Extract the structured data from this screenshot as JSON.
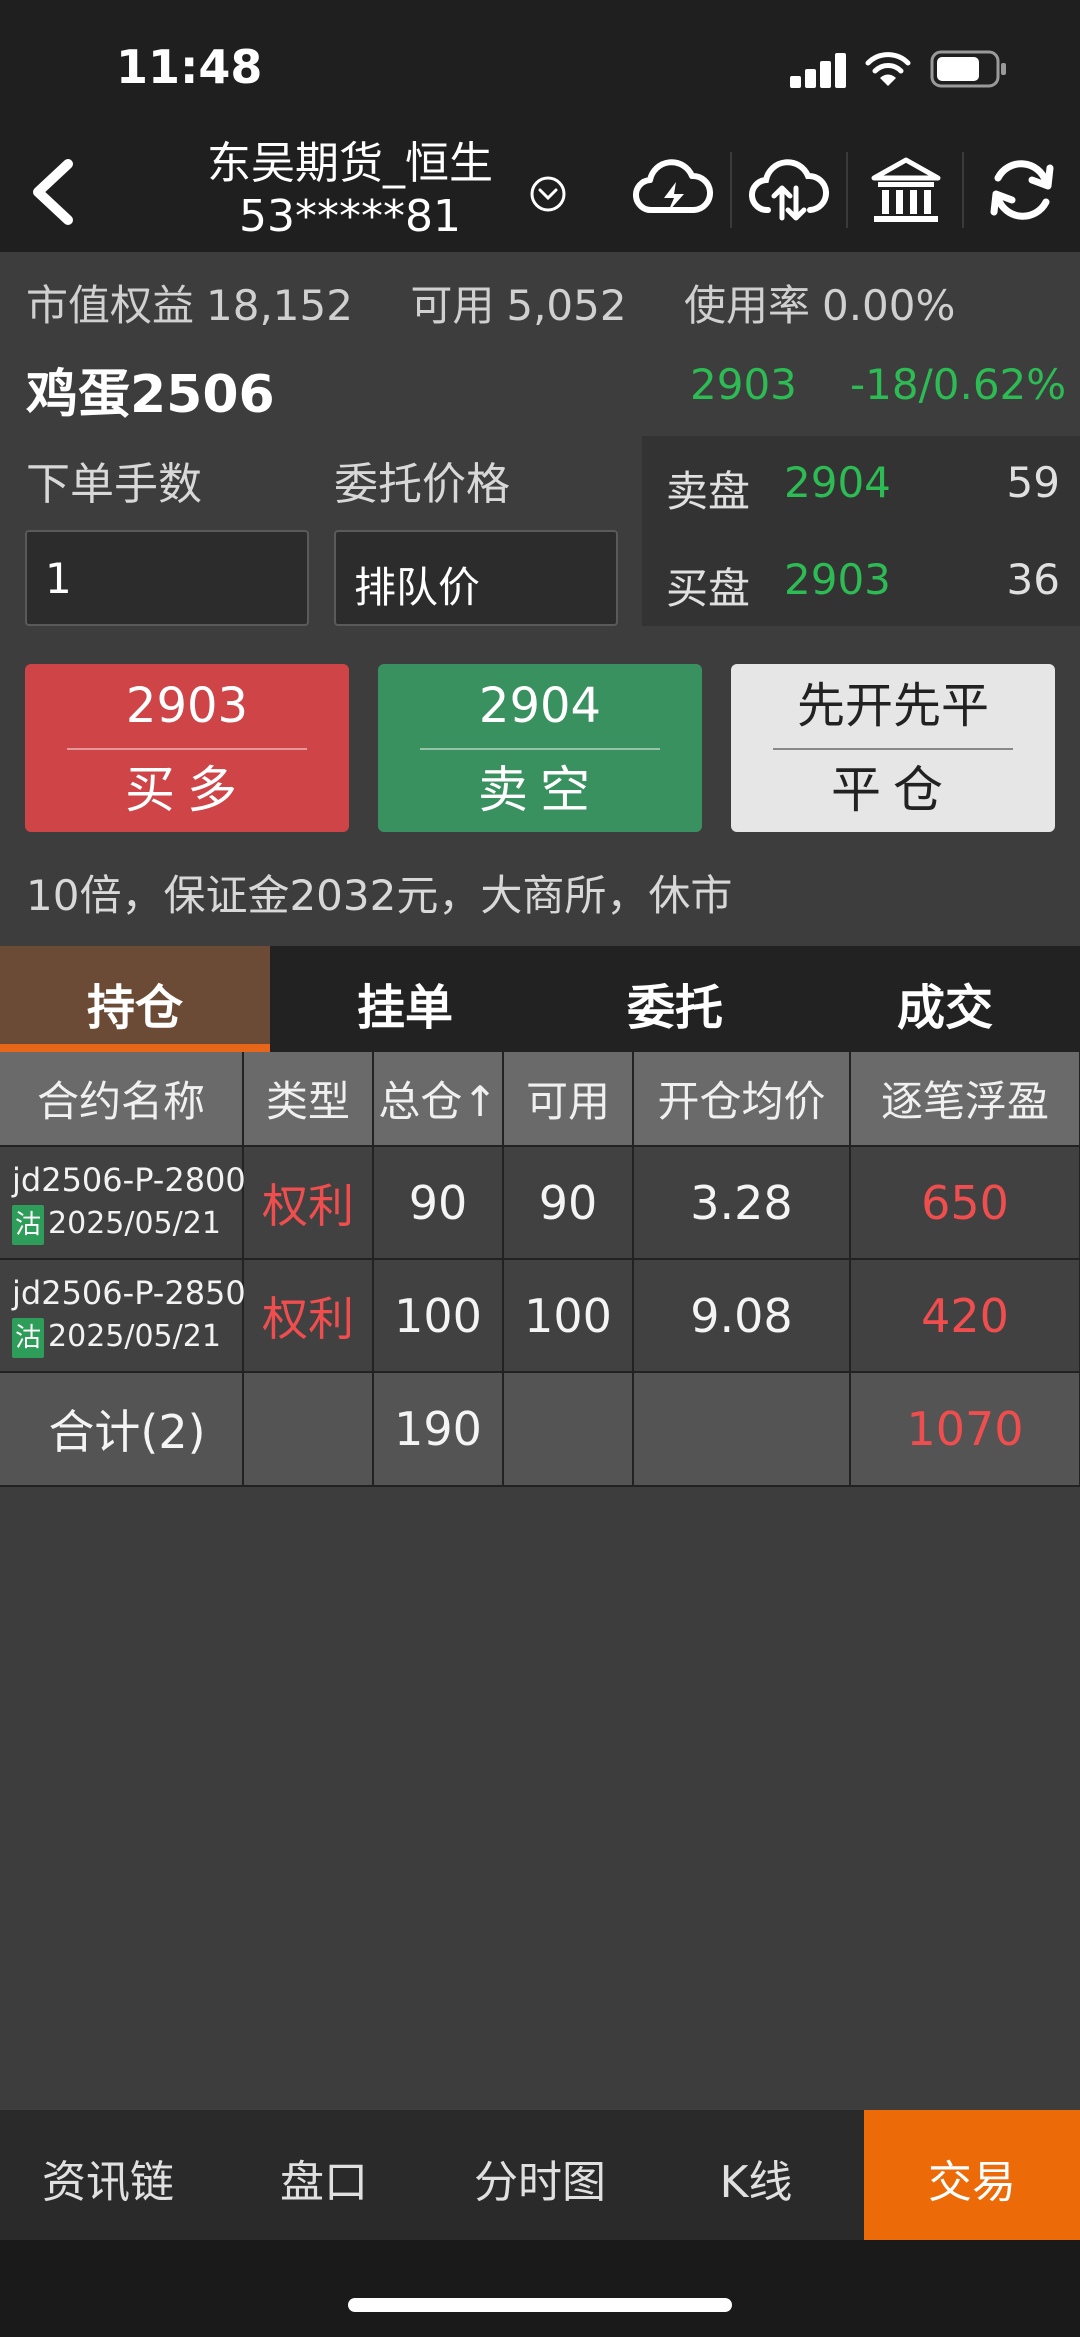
{
  "status_bar": {
    "time": "11:48"
  },
  "header": {
    "account_name": "东吴期货_恒生",
    "account_id": "53*****81"
  },
  "account": {
    "equity_label": "市值权益",
    "equity": "18,152",
    "available_label": "可用",
    "available": "5,052",
    "usage_label": "使用率",
    "usage": "0.00%"
  },
  "contract": {
    "name": "鸡蛋2506",
    "last_price": "2903",
    "change": "-18/0.62%"
  },
  "order_form": {
    "lots_label": "下单手数",
    "lots_value": "1",
    "price_label": "委托价格",
    "price_value": "排队价"
  },
  "order_book": {
    "ask": {
      "label": "卖盘",
      "price": "2904",
      "volume": "59"
    },
    "bid": {
      "label": "买盘",
      "price": "2903",
      "volume": "36"
    }
  },
  "actions": {
    "buy": {
      "price": "2903",
      "label": "买多"
    },
    "sell": {
      "price": "2904",
      "label": "卖空"
    },
    "close": {
      "mode": "先开先平",
      "label": "平仓"
    }
  },
  "margin_note": "10倍，保证金2032元，大商所，休市",
  "tabs": [
    "持仓",
    "挂单",
    "委托",
    "成交"
  ],
  "positions": {
    "columns": [
      "合约名称",
      "类型",
      "总仓↑",
      "可用",
      "开仓均价",
      "逐笔浮盈"
    ],
    "rows": [
      {
        "code": "jd2506-P-2800",
        "badge": "沽",
        "date": "2025/05/21",
        "type": "权利",
        "total": "90",
        "available": "90",
        "avg_price": "3.28",
        "pnl": "650"
      },
      {
        "code": "jd2506-P-2850",
        "badge": "沽",
        "date": "2025/05/21",
        "type": "权利",
        "total": "100",
        "available": "100",
        "avg_price": "9.08",
        "pnl": "420"
      }
    ],
    "total": {
      "label": "合计(2)",
      "total": "190",
      "pnl": "1070"
    }
  },
  "bottom_nav": [
    "资讯链",
    "盘口",
    "分时图",
    "K线",
    "交易"
  ],
  "colors": {
    "up": "#2dbb54",
    "down": "#f04e4e",
    "accent": "#ec6a08",
    "buy": "#cf4446",
    "sell": "#3a9160"
  }
}
